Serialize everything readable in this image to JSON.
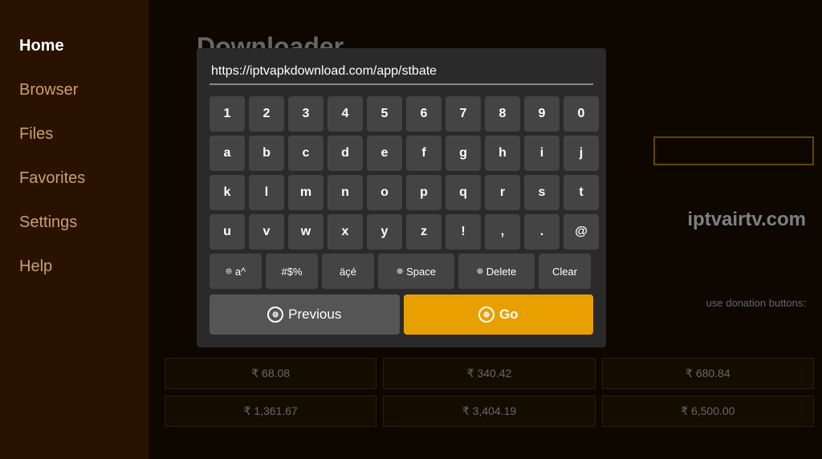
{
  "sidebar": {
    "items": [
      {
        "label": "Home",
        "active": true
      },
      {
        "label": "Browser",
        "active": false
      },
      {
        "label": "Files",
        "active": false
      },
      {
        "label": "Favorites",
        "active": false
      },
      {
        "label": "Settings",
        "active": false
      },
      {
        "label": "Help",
        "active": false
      }
    ]
  },
  "main": {
    "title": "Downloader",
    "iptvair_text": "iptvairtv.com",
    "donation_text": "use donation buttons:",
    "donation_sub": ")"
  },
  "modal": {
    "url_value": "https://iptvapkdownload.com/app/stbate",
    "keyboard": {
      "row1": [
        "1",
        "2",
        "3",
        "4",
        "5",
        "6",
        "7",
        "8",
        "9",
        "0"
      ],
      "row2": [
        "a",
        "b",
        "c",
        "d",
        "e",
        "f",
        "g",
        "h",
        "i",
        "j"
      ],
      "row3": [
        "k",
        "l",
        "m",
        "n",
        "o",
        "p",
        "q",
        "r",
        "s",
        "t"
      ],
      "row4": [
        "u",
        "v",
        "w",
        "x",
        "y",
        "z",
        "!",
        ",",
        ".",
        "@"
      ]
    },
    "special_keys": {
      "layout_label": "a^",
      "symbols_label": "#$%",
      "accents_label": "äçé",
      "space_label": "Space",
      "delete_label": "Delete",
      "clear_label": "Clear"
    },
    "nav": {
      "previous_label": "Previous",
      "go_label": "Go"
    }
  },
  "prices": {
    "row1": [
      "₹ 68.08",
      "₹ 340.42",
      "₹ 680.84"
    ],
    "row2": [
      "₹ 1,361.67",
      "₹ 3,404.19",
      "₹ 6,500.00"
    ]
  }
}
